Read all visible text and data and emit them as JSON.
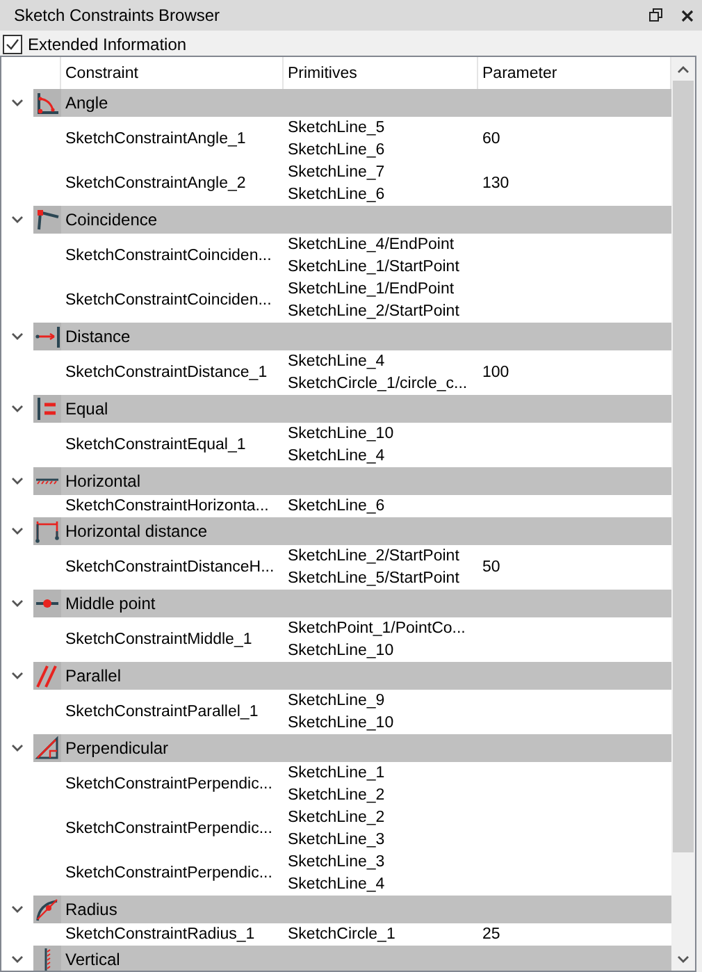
{
  "window": {
    "title": "Sketch Constraints Browser"
  },
  "extended_information": {
    "label": "Extended Information",
    "checked": true
  },
  "columns": [
    "Constraint",
    "Primitives",
    "Parameter"
  ],
  "groups": [
    {
      "name": "Angle",
      "kind": "angle",
      "expanded": true,
      "rows": [
        {
          "constraint": "SketchConstraintAngle_1",
          "primitives": [
            "SketchLine_5",
            "SketchLine_6"
          ],
          "parameter": "60"
        },
        {
          "constraint": "SketchConstraintAngle_2",
          "primitives": [
            "SketchLine_7",
            "SketchLine_6"
          ],
          "parameter": "130"
        }
      ]
    },
    {
      "name": "Coincidence",
      "kind": "coincidence",
      "expanded": true,
      "rows": [
        {
          "constraint": "SketchConstraintCoinciden...",
          "primitives": [
            "SketchLine_4/EndPoint",
            "SketchLine_1/StartPoint"
          ]
        },
        {
          "constraint": "SketchConstraintCoinciden...",
          "primitives": [
            "SketchLine_1/EndPoint",
            "SketchLine_2/StartPoint"
          ]
        }
      ]
    },
    {
      "name": "Distance",
      "kind": "distance",
      "expanded": true,
      "rows": [
        {
          "constraint": "SketchConstraintDistance_1",
          "primitives": [
            "SketchLine_4",
            "SketchCircle_1/circle_c..."
          ],
          "parameter": "100"
        }
      ]
    },
    {
      "name": "Equal",
      "kind": "equal",
      "expanded": true,
      "rows": [
        {
          "constraint": "SketchConstraintEqual_1",
          "primitives": [
            "SketchLine_10",
            "SketchLine_4"
          ]
        }
      ]
    },
    {
      "name": "Horizontal",
      "kind": "horizontal",
      "expanded": true,
      "rows": [
        {
          "constraint": "SketchConstraintHorizonta...",
          "primitives": [
            "SketchLine_6"
          ]
        }
      ]
    },
    {
      "name": "Horizontal distance",
      "kind": "horizontal_distance",
      "expanded": true,
      "rows": [
        {
          "constraint": "SketchConstraintDistanceH...",
          "primitives": [
            "SketchLine_2/StartPoint",
            "SketchLine_5/StartPoint"
          ],
          "parameter": "50"
        }
      ]
    },
    {
      "name": "Middle point",
      "kind": "middle_point",
      "expanded": true,
      "rows": [
        {
          "constraint": "SketchConstraintMiddle_1",
          "primitives": [
            "SketchPoint_1/PointCo...",
            "SketchLine_10"
          ]
        }
      ]
    },
    {
      "name": "Parallel",
      "kind": "parallel",
      "expanded": true,
      "rows": [
        {
          "constraint": "SketchConstraintParallel_1",
          "primitives": [
            "SketchLine_9",
            "SketchLine_10"
          ]
        }
      ]
    },
    {
      "name": "Perpendicular",
      "kind": "perpendicular",
      "expanded": true,
      "rows": [
        {
          "constraint": "SketchConstraintPerpendic...",
          "primitives": [
            "SketchLine_1",
            "SketchLine_2"
          ]
        },
        {
          "constraint": "SketchConstraintPerpendic...",
          "primitives": [
            "SketchLine_2",
            "SketchLine_3"
          ]
        },
        {
          "constraint": "SketchConstraintPerpendic...",
          "primitives": [
            "SketchLine_3",
            "SketchLine_4"
          ]
        }
      ]
    },
    {
      "name": "Radius",
      "kind": "radius",
      "expanded": true,
      "rows": [
        {
          "constraint": "SketchConstraintRadius_1",
          "primitives": [
            "SketchCircle_1"
          ],
          "parameter": "25"
        }
      ]
    },
    {
      "name": "Vertical",
      "kind": "vertical",
      "expanded": true
    }
  ]
}
